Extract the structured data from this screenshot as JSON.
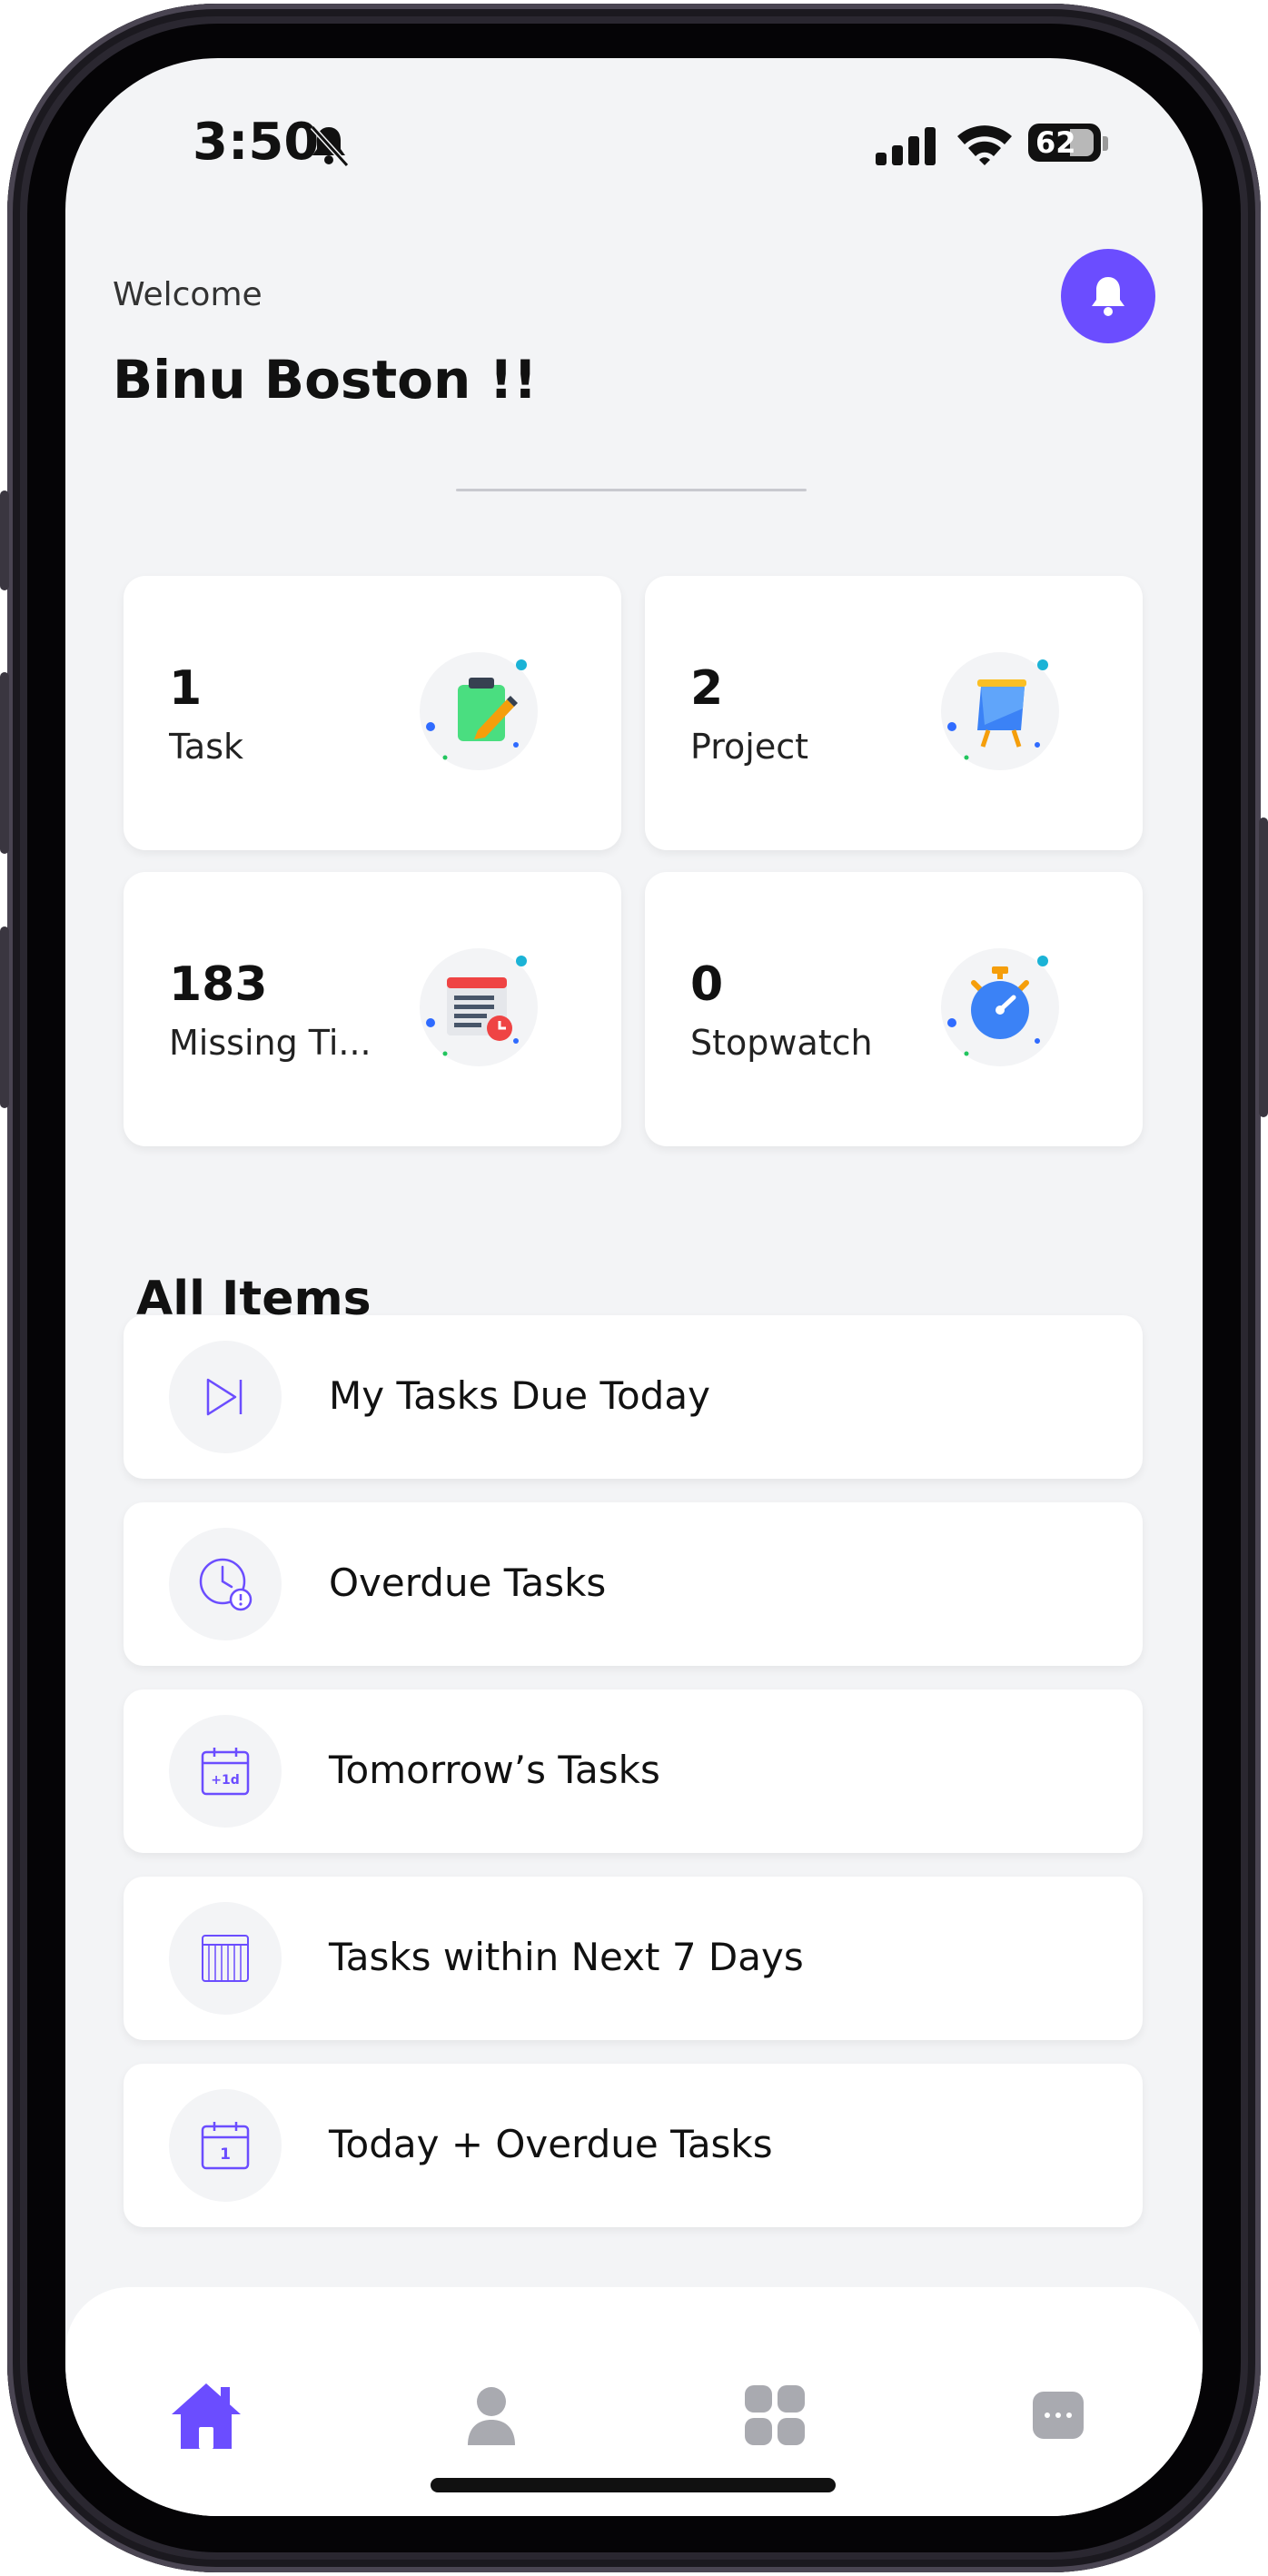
{
  "status_bar": {
    "time": "3:50",
    "battery": "62"
  },
  "header": {
    "greeting": "Welcome",
    "user_name": "Binu Boston !!"
  },
  "stats": [
    {
      "count": "1",
      "label": "Task",
      "icon": "clipboard-pencil-icon"
    },
    {
      "count": "2",
      "label": "Project",
      "icon": "easel-board-icon"
    },
    {
      "count": "183",
      "label": "Missing Ti...",
      "icon": "timesheet-clock-icon"
    },
    {
      "count": "0",
      "label": "Stopwatch",
      "icon": "stopwatch-icon"
    }
  ],
  "section": {
    "title": "All Items"
  },
  "items": [
    {
      "label": "My Tasks Due Today",
      "icon": "skip-forward-icon"
    },
    {
      "label": "Overdue Tasks",
      "icon": "clock-alert-icon"
    },
    {
      "label": "Tomorrow’s Tasks",
      "icon": "calendar-plus-one-day-icon"
    },
    {
      "label": "Tasks within Next 7 Days",
      "icon": "calendar-week-icon"
    },
    {
      "label": "Today + Overdue Tasks",
      "icon": "calendar-day-one-icon"
    }
  ],
  "bottom_nav": [
    {
      "icon": "home-icon",
      "active": true
    },
    {
      "icon": "profile-icon",
      "active": false
    },
    {
      "icon": "apps-grid-icon",
      "active": false
    },
    {
      "icon": "chat-more-icon",
      "active": false
    }
  ],
  "colors": {
    "accent": "#6b4dff",
    "background": "#f3f4f6",
    "card": "#ffffff",
    "inactive_nav": "#a9aab0"
  }
}
